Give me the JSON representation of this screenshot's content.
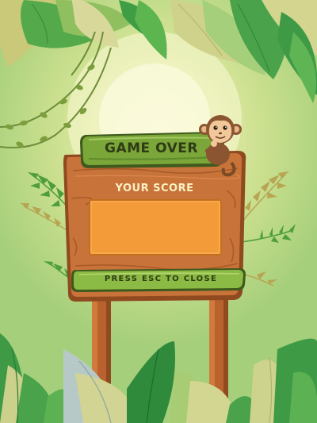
{
  "game_over": {
    "title": "GAME OVER",
    "score_label": "YOUR SCORE",
    "score_value": "",
    "close_hint": "PRESS ESC TO CLOSE"
  },
  "mascot": {
    "icon": "monkey-icon"
  },
  "colors": {
    "wood": "#c8733a",
    "wood_dark": "#8f4a1f",
    "plank_green": "#6f9a34",
    "score_box": "#f39b38",
    "text_dark": "#2f3b14",
    "label_light": "#fbf1c4"
  }
}
